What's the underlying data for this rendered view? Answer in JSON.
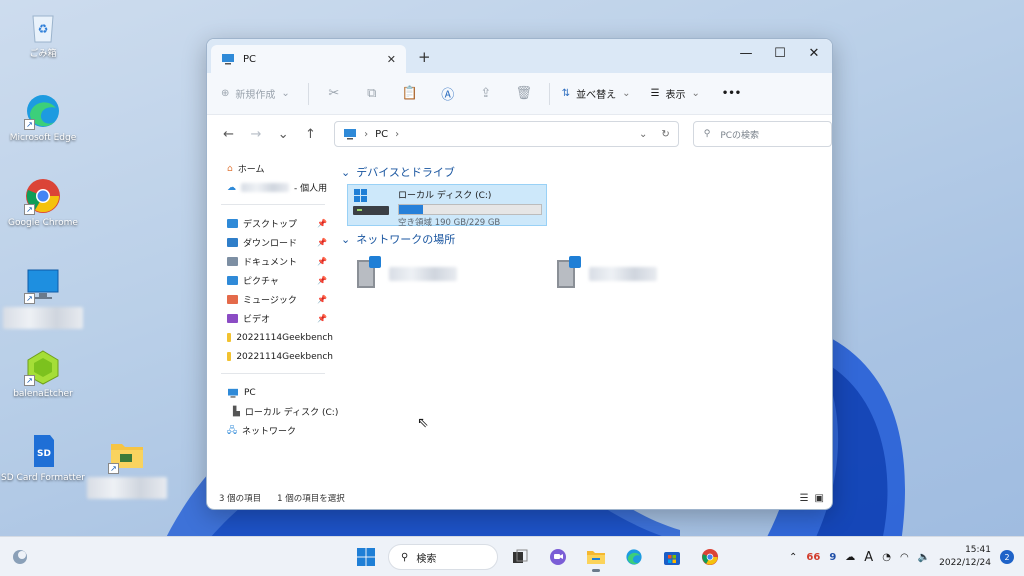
{
  "desktop": {
    "icons": [
      {
        "label": "ごみ箱",
        "icon": "recycle-bin-icon"
      },
      {
        "label": "Microsoft Edge",
        "icon": "edge-icon"
      },
      {
        "label": "Google Chrome",
        "icon": "chrome-icon"
      },
      {
        "label": "",
        "icon": "monitor-icon"
      },
      {
        "label": "balenaEtcher",
        "icon": "balena-etcher-icon"
      },
      {
        "label": "SD Card Formatter",
        "icon": "sd-card-icon"
      },
      {
        "label": "",
        "icon": "folder-shortcut-icon"
      }
    ]
  },
  "window": {
    "tab_title": "PC",
    "controls": {
      "minimize": "—",
      "maximize": "☐",
      "close": "✕"
    },
    "commandbar": {
      "new_label": "新規作成",
      "sort_label": "並べ替え",
      "view_label": "表示",
      "more_label": "•••"
    },
    "address": {
      "crumb": "PC"
    },
    "search_placeholder": "PCの検索",
    "sidebar": {
      "home": "ホーム",
      "onedrive_suffix": "- 個人用",
      "quick": [
        {
          "label": "デスクトップ",
          "pinned": true,
          "color": "#2f8ad8"
        },
        {
          "label": "ダウンロード",
          "pinned": true,
          "color": "#2f7ec9"
        },
        {
          "label": "ドキュメント",
          "pinned": true,
          "color": "#7d8fa3"
        },
        {
          "label": "ピクチャ",
          "pinned": true,
          "color": "#2f8ad8"
        },
        {
          "label": "ミュージック",
          "pinned": true,
          "color": "#e46a4a"
        },
        {
          "label": "ビデオ",
          "pinned": true,
          "color": "#8b4cc4"
        },
        {
          "label": "20221114Geekbench",
          "pinned": false,
          "color": "#f2c230"
        },
        {
          "label": "20221114Geekbench",
          "pinned": false,
          "color": "#f2c230"
        }
      ],
      "pc": "PC",
      "local_disk": "ローカル ディスク (C:)",
      "network": "ネットワーク"
    },
    "content": {
      "devices_header": "デバイスとドライブ",
      "drive": {
        "name": "ローカル ディスク (C:)",
        "free_text": "空き領域 190 GB/229 GB",
        "used_fraction": 0.17
      },
      "network_header": "ネットワークの場所"
    },
    "status": {
      "items": "3 個の項目",
      "selected": "1 個の項目を選択"
    }
  },
  "taskbar": {
    "search_label": "検索",
    "tray": {
      "badge_a": "66",
      "badge_b": "9",
      "ime": "A"
    },
    "clock": {
      "time": "15:41",
      "date": "2022/12/24"
    },
    "notifications": "2"
  }
}
